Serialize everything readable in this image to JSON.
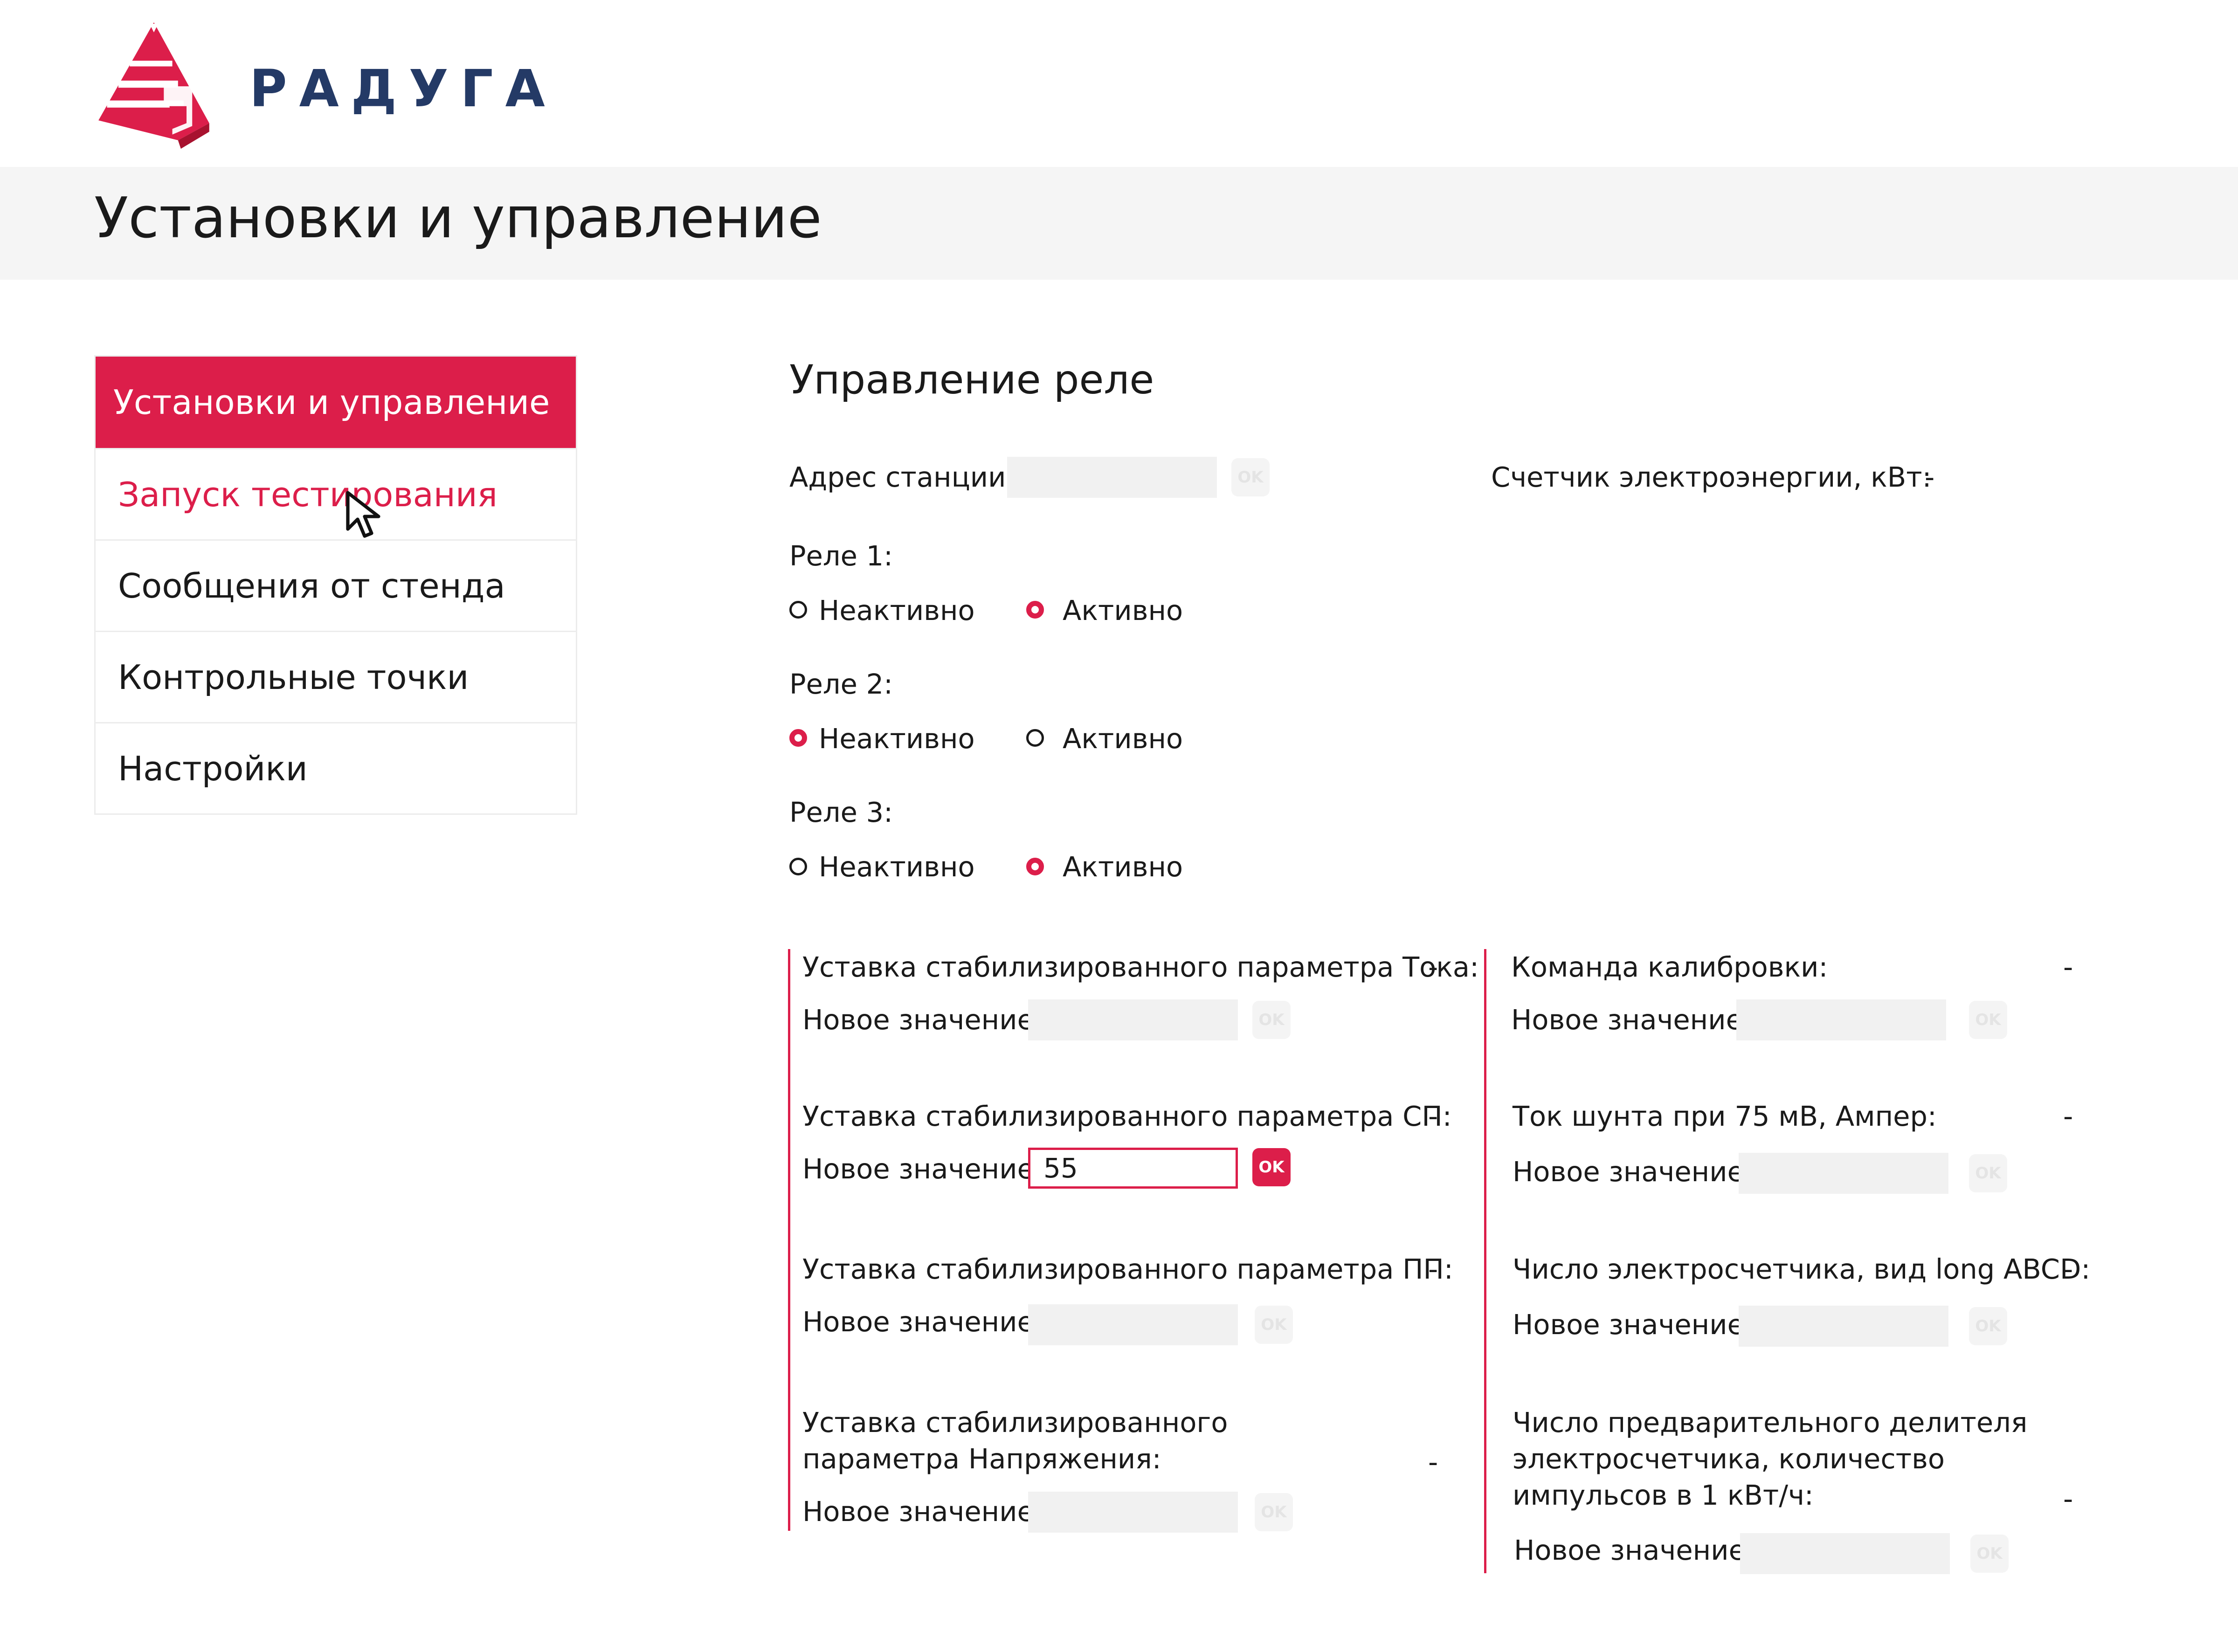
{
  "header": {
    "brand": "РАДУГА",
    "page_title": "Установки и управление"
  },
  "sidebar": {
    "items": [
      {
        "label": "Установки и управление",
        "state": "active"
      },
      {
        "label": "Запуск тестирования",
        "state": "hover"
      },
      {
        "label": "Сообщения от стенда",
        "state": "normal"
      },
      {
        "label": "Контрольные точки",
        "state": "normal"
      },
      {
        "label": "Настройки",
        "state": "normal"
      }
    ]
  },
  "main": {
    "section_title": "Управление реле",
    "station_label": "Адрес станции:",
    "station_value": "",
    "ok": "OK",
    "meter_label": "Счетчик электроэнергии, кВт:",
    "meter_value": "-",
    "option_inactive": "Неактивно",
    "option_active": "Активно",
    "relays": [
      {
        "label": "Реле 1:",
        "selected": "Активно"
      },
      {
        "label": "Реле 2:",
        "selected": "Неактивно"
      },
      {
        "label": "Реле 3:",
        "selected": "Активно"
      }
    ],
    "new_value_label": "Новое значение:",
    "left_params": [
      {
        "label": "Уставка стабилизированного параметра Тока:",
        "value": "-",
        "input": ""
      },
      {
        "label": "Уставка стабилизированного параметра СП:",
        "value": "-",
        "input": "55"
      },
      {
        "label": "Уставка стабилизированного параметра ПП:",
        "value": "-",
        "input": ""
      },
      {
        "label": "Уставка стабилизированного параметра Напряжения:",
        "value": "-",
        "input": ""
      }
    ],
    "right_params": [
      {
        "label": "Команда калибровки:",
        "value": "-",
        "input": ""
      },
      {
        "label": "Ток шунта при 75 мВ, Ампер:",
        "value": "-",
        "input": ""
      },
      {
        "label": "Число электросчетчика, вид long ABCD:",
        "value": "-",
        "input": ""
      },
      {
        "label": "Число предварительного делителя электросчетчика, количество импульсов в 1 кВт/ч:",
        "value": "-",
        "input": ""
      }
    ]
  },
  "colors": {
    "accent": "#dc1e4a",
    "brand": "#243a66",
    "title_bar": "#f5f5f5"
  },
  "icons": [
    "rainbow-pyramid-logo",
    "mouse-pointer-icon"
  ]
}
